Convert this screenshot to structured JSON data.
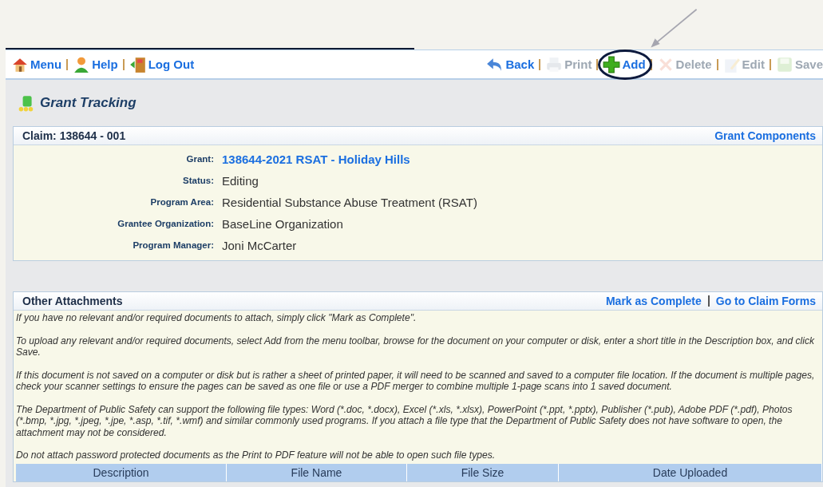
{
  "toolbar_left": [
    {
      "label": "Menu"
    },
    {
      "label": "Help"
    },
    {
      "label": "Log Out"
    }
  ],
  "toolbar_right": [
    {
      "label": "Back",
      "disabled": false,
      "highlighted": false
    },
    {
      "label": "Print",
      "disabled": true,
      "highlighted": false
    },
    {
      "label": "Add",
      "disabled": false,
      "highlighted": true
    },
    {
      "label": "Delete",
      "disabled": true,
      "highlighted": false
    },
    {
      "label": "Edit",
      "disabled": true,
      "highlighted": false
    },
    {
      "label": "Save",
      "disabled": true,
      "highlighted": false
    }
  ],
  "page_title": "Grant Tracking",
  "claim_panel": {
    "title": "Claim: 138644 - 001",
    "link": "Grant Components",
    "fields": [
      {
        "label": "Grant:",
        "value": "138644-2021 RSAT - Holiday Hills",
        "kind": "link"
      },
      {
        "label": "Status:",
        "value": "Editing",
        "kind": "text"
      },
      {
        "label": "Program Area:",
        "value": "Residential Substance Abuse Treatment (RSAT)",
        "kind": "text"
      },
      {
        "label": "Grantee Organization:",
        "value": "BaseLine Organization",
        "kind": "text"
      },
      {
        "label": "Program Manager:",
        "value": "Joni McCarter",
        "kind": "text"
      }
    ]
  },
  "attachments_panel": {
    "title": "Other Attachments",
    "links": [
      "Mark as Complete",
      "Go to Claim Forms"
    ],
    "paragraphs": [
      "If you have no relevant and/or required documents to attach, simply click \"Mark as Complete\".",
      "To upload any relevant and/or required documents, select Add from the menu toolbar, browse for the document on your computer or disk, enter a short title in the Description box, and click Save.",
      "If this document is not saved on a computer or disk but is rather a sheet of printed paper, it will need to be scanned and saved to a computer file location. If the document is multiple pages, check your scanner settings to ensure the pages can be saved as one file or use a PDF merger to combine multiple 1-page scans into 1 saved document.",
      "The Department of Public Safety can support the following file types: Word (*.doc, *.docx), Excel (*.xls, *.xlsx), PowerPoint (*.ppt, *.pptx), Publisher (*.pub), Adobe PDF (*.pdf), Photos (*.bmp, *.jpg, *.jpeg, *.jpe, *.asp, *.tif, *.wmf) and similar commonly used programs. If you attach a file type that the Department of Public Safety does not have software to open, the attachment may not be considered.",
      "Do not attach password protected documents as the Print to PDF feature will not be able to open such file types."
    ],
    "table": {
      "columns": [
        "Description",
        "File Name",
        "File Size",
        "Date Uploaded"
      ]
    }
  }
}
